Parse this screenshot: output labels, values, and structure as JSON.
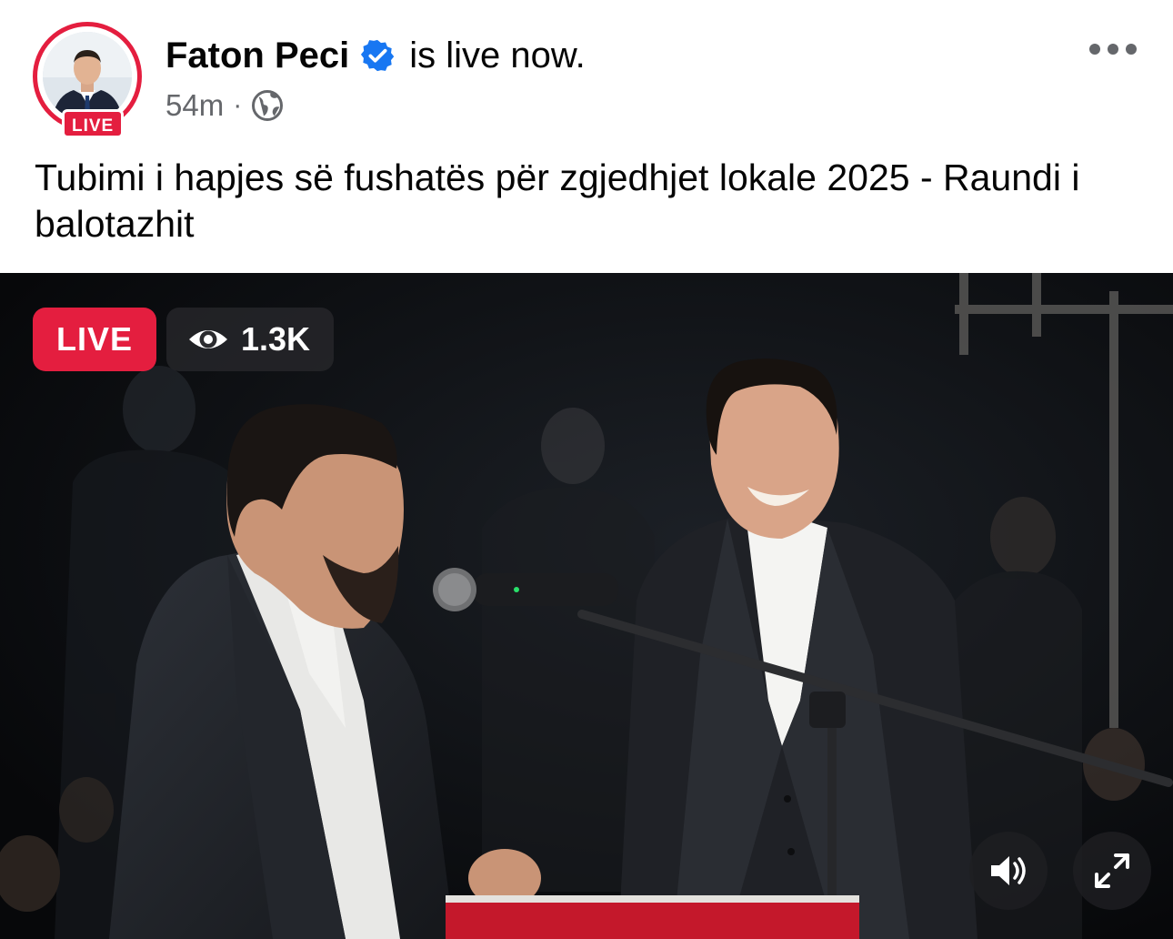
{
  "post": {
    "author_name": "Faton Peci",
    "verified": true,
    "status_text": "is live now.",
    "time_ago": "54m",
    "separator": "·",
    "audience_icon": "globe-icon",
    "avatar_live_label": "LIVE",
    "caption": "Tubimi i hapjes së fushatës për zgjedhjet lokale 2025 - Raundi i balotazhit",
    "more_icon": "more-options-icon"
  },
  "video": {
    "live_label": "LIVE",
    "viewer_count": "1.3K",
    "viewer_icon": "eye-icon",
    "controls": {
      "sound_icon": "speaker-icon",
      "fullscreen_icon": "expand-icon"
    }
  },
  "colors": {
    "live_red": "#e41e3f",
    "verified_blue": "#1877f2",
    "meta_gray": "#65676b",
    "text": "#050505"
  }
}
